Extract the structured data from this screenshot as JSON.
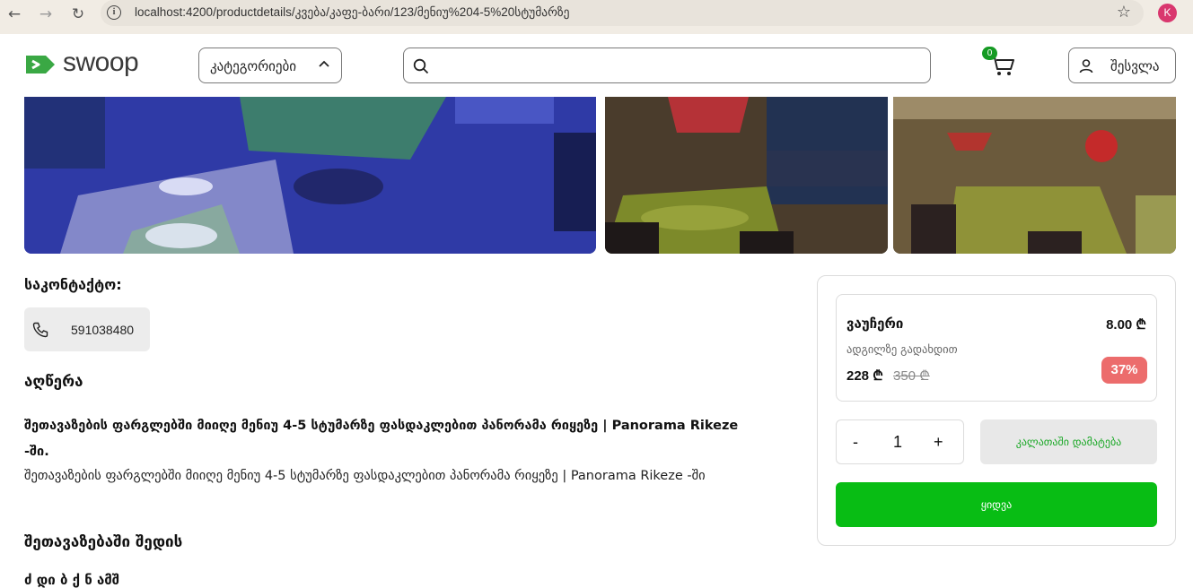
{
  "browser": {
    "url": "localhost:4200/productdetails/კვება/კაფე-ბარი/123/მენიუ%204-5%20სტუმარზე",
    "profile_initial": "K",
    "back_icon": "arrow-left-icon",
    "forward_icon": "arrow-right-icon",
    "reload_icon": "reload-icon",
    "star_icon": "star-icon"
  },
  "header": {
    "logo_text": "swoop",
    "categories_label": "კატეგორიები",
    "search_placeholder": "",
    "cart_count": "0",
    "login_label": "შესვლა"
  },
  "contact": {
    "title": "საკონტაქტო:",
    "phone": "591038480"
  },
  "description": {
    "title": "აღწერა",
    "bold_text": "შეთავაზების ფარგლებში მიიღე მენიუ 4-5 სტუმარზე ფასდაკლებით პანორამა რიყეზე | Panorama Rikeze -ში.",
    "normal_text": "შეთავაზების ფარგლებში მიიღე მენიუ 4-5 სტუმარზე ფასდაკლებით პანორამა რიყეზე | Panorama Rikeze -ში"
  },
  "includes": {
    "title": "შეთავაზებაში შედის",
    "partial_line": "ძ დი ბ ქ ნ ამშ"
  },
  "voucher": {
    "title": "ვაუჩერი",
    "price": "8.00 ₾",
    "subtitle": "ადგილზე გადახდით",
    "new_price": "228 ₾",
    "old_price": "350 ₾",
    "discount": "37%"
  },
  "purchase": {
    "minus": "-",
    "quantity": "1",
    "plus": "+",
    "add_to_cart": "კალათაში დამატება",
    "buy": "ყიდვა"
  },
  "colors": {
    "brand_green": "#08bd14",
    "badge_red": "#ec6c6c",
    "cart_badge": "#159a23"
  }
}
